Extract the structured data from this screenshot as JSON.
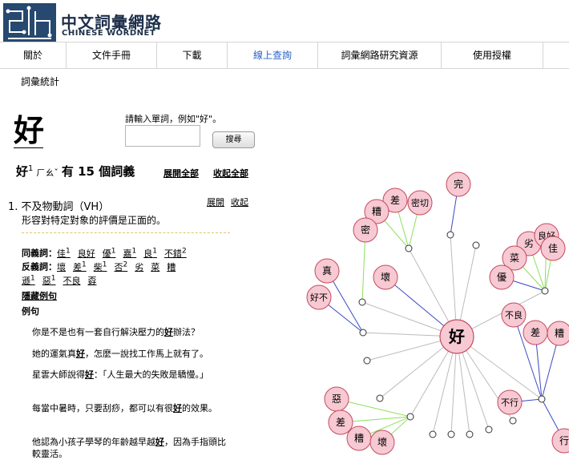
{
  "header": {
    "logo_title": "中文詞彙網路",
    "logo_subtitle": "CHINESE WORDNET"
  },
  "nav": [
    {
      "label": "關於",
      "active": false
    },
    {
      "label": "文件手冊",
      "active": false
    },
    {
      "label": "下載",
      "active": false
    },
    {
      "label": "線上查詢",
      "active": true
    },
    {
      "label": "詞彙網路研究資源",
      "active": false
    },
    {
      "label": "使用授權",
      "active": false
    }
  ],
  "subnav": "詞彙統計",
  "search": {
    "word": "好",
    "prompt": "請輸入單詞，例如\"好\"。",
    "input_value": "",
    "button_label": "搜尋"
  },
  "summary": {
    "word": "好",
    "sup": "1",
    "zhuyin": "ㄏㄠˇ",
    "count_text": "有 15 個詞義",
    "expand_all": "展開全部",
    "collapse_all": "收起全部"
  },
  "sense": {
    "head": "1.  不及物動詞（VH）",
    "expand": "展開",
    "collapse": "收起",
    "definition": "形容對特定對象的評價是正面的。",
    "synonym_label": "同義詞：",
    "synonyms": [
      {
        "w": "佳",
        "s": "1"
      },
      {
        "w": "良好",
        "s": ""
      },
      {
        "w": "優",
        "s": "1"
      },
      {
        "w": "嘉",
        "s": "1"
      },
      {
        "w": "良",
        "s": "1"
      },
      {
        "w": "不錯",
        "s": "2"
      }
    ],
    "antonym_label": "反義詞：",
    "antonyms": [
      {
        "w": "壞",
        "s": ""
      },
      {
        "w": "差",
        "s": "1"
      },
      {
        "w": "柴",
        "s": "1"
      },
      {
        "w": "否",
        "s": "2"
      },
      {
        "w": "劣",
        "s": ""
      },
      {
        "w": "菜",
        "s": ""
      },
      {
        "w": "糟",
        "s": ""
      }
    ],
    "antonyms2": [
      {
        "w": "遜",
        "s": "1"
      },
      {
        "w": "惡",
        "s": "1"
      },
      {
        "w": "不良",
        "s": ""
      },
      {
        "w": "孬",
        "s": ""
      }
    ],
    "hide_examples": "隱藏例句",
    "examples_label": "例句",
    "examples": [
      {
        "pre": "你是不是也有一套自行解決壓力的",
        "kw": "好",
        "post": "辦法？"
      },
      {
        "pre": "她的運氣真",
        "kw": "好",
        "post": "，怎麼一說找工作馬上就有了。"
      },
      {
        "pre": "星雲大師說得",
        "kw": "好",
        "post": "：「人生最大的失敗是驕慢。」"
      },
      {
        "pre": "每當中暑時，只要刮痧，都可以有很",
        "kw": "好",
        "post": "的效果。"
      },
      {
        "pre": "他認為小孩子學琴的年齡越早越",
        "kw": "好",
        "post": "，因為手指頭比較靈活。"
      }
    ]
  },
  "graph": {
    "center": "好",
    "nodes": [
      "完",
      "差",
      "密切",
      "糟",
      "密",
      "壞",
      "真",
      "好不",
      "劣",
      "良好",
      "佳",
      "菜",
      "優",
      "不良",
      "差",
      "糟",
      "惡",
      "差",
      "糟",
      "壞",
      "不行",
      "行"
    ],
    "colors": {
      "node_fill": "#f7c9d3",
      "node_stroke": "#c44a5d",
      "synonym_edge": "#8be05a",
      "antonym_edge": "#3b49c4",
      "hub_edge": "#bbbbbb"
    }
  }
}
